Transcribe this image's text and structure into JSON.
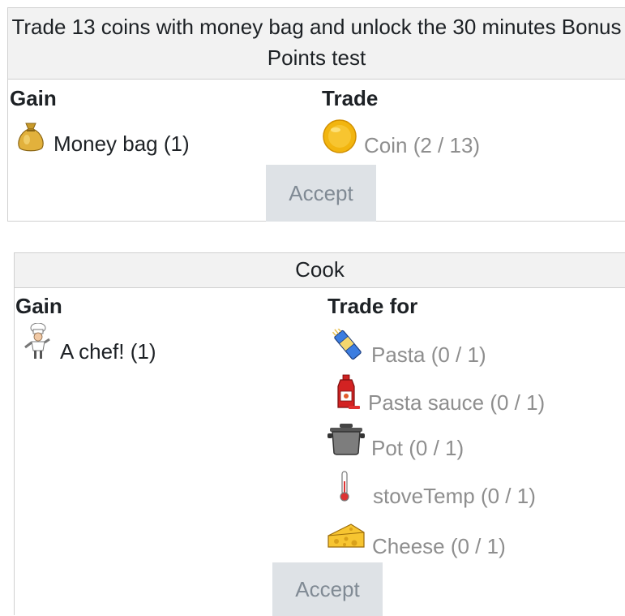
{
  "offer1": {
    "title": "Trade 13 coins with money bag and unlock the 30 minutes Bonus Points test",
    "gain_header": "Gain",
    "trade_header": "Trade",
    "gain_items": [
      {
        "label": "Money bag (1)",
        "icon": "money-bag-icon"
      }
    ],
    "trade_items": [
      {
        "label": "Coin (2 / 13)",
        "icon": "coin-icon"
      }
    ],
    "accept_label": "Accept"
  },
  "offer2": {
    "title": "Cook",
    "gain_header": "Gain",
    "trade_header": "Trade for",
    "gain_items": [
      {
        "label": "A chef! (1)",
        "icon": "chef-icon"
      }
    ],
    "trade_items": [
      {
        "label": "Pasta (0 / 1)",
        "icon": "pasta-icon"
      },
      {
        "label": "Pasta sauce (0 / 1)",
        "icon": "ketchup-bottle-icon"
      },
      {
        "label": "Pot (0 / 1)",
        "icon": "pot-icon"
      },
      {
        "label": "stoveTemp (0 / 1)",
        "icon": "thermometer-icon"
      },
      {
        "label": "Cheese (0 / 1)",
        "icon": "cheese-icon"
      }
    ],
    "accept_label": "Accept"
  }
}
